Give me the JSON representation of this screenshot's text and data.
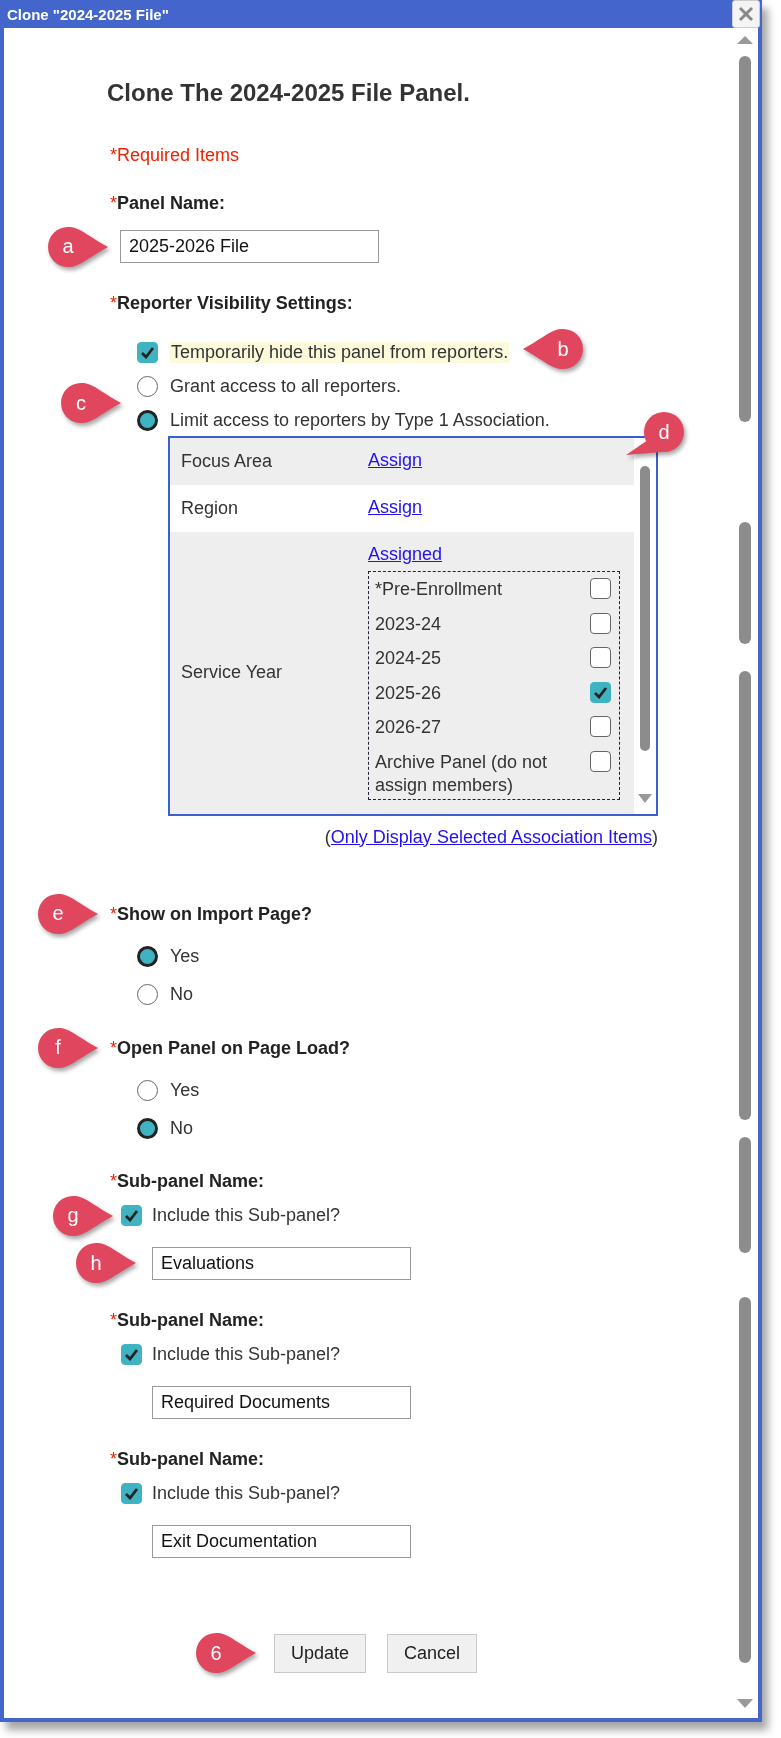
{
  "window": {
    "title": "Clone \"2024-2025 File\""
  },
  "heading": "Clone The 2024-2025 File Panel.",
  "required_note": "*Required Items",
  "panel_name": {
    "required_mark": "*",
    "label": "Panel Name:",
    "value": "2025-2026 File",
    "callout": "a"
  },
  "visibility": {
    "required_mark": "*",
    "label": "Reporter Visibility Settings:",
    "hide": {
      "label": "Temporarily hide this panel from reporters.",
      "checked": true,
      "highlighted": true,
      "callout": "b"
    },
    "access_callout": "c",
    "access_options": [
      {
        "label": "Grant access to all reporters.",
        "selected": false
      },
      {
        "label": "Limit access to reporters by Type 1 Association.",
        "selected": true
      }
    ]
  },
  "associations": {
    "callout": "d",
    "rows": [
      {
        "name": "Focus Area",
        "link": "Assign"
      },
      {
        "name": "Region",
        "link": "Assign"
      },
      {
        "name": "Service Year",
        "link": "Assigned",
        "items": [
          {
            "label": "*Pre-Enrollment",
            "checked": false
          },
          {
            "label": "2023-24",
            "checked": false
          },
          {
            "label": "2024-25",
            "checked": false
          },
          {
            "label": "2025-26",
            "checked": true
          },
          {
            "label": "2026-27",
            "checked": false
          },
          {
            "label": "Archive Panel (do not assign members)",
            "checked": false
          }
        ]
      }
    ],
    "footer_open": "(",
    "footer_link": "Only Display Selected Association Items",
    "footer_close": ")"
  },
  "questions": [
    {
      "required_mark": "*",
      "label": "Show on Import Page?",
      "callout": "e",
      "options": [
        {
          "label": "Yes",
          "selected": true
        },
        {
          "label": "No",
          "selected": false
        }
      ]
    },
    {
      "required_mark": "*",
      "label": "Open Panel on Page Load?",
      "callout": "f",
      "options": [
        {
          "label": "Yes",
          "selected": false
        },
        {
          "label": "No",
          "selected": true
        }
      ]
    }
  ],
  "subpanels": [
    {
      "required_mark": "*",
      "label": "Sub-panel Name:",
      "include_label": "Include this Sub-panel?",
      "include_checked": true,
      "include_callout": "g",
      "value": "Evaluations",
      "field_callout": "h"
    },
    {
      "required_mark": "*",
      "label": "Sub-panel Name:",
      "include_label": "Include this Sub-panel?",
      "include_checked": true,
      "value": "Required Documents"
    },
    {
      "required_mark": "*",
      "label": "Sub-panel Name:",
      "include_label": "Include this Sub-panel?",
      "include_checked": true,
      "value": "Exit Documentation"
    }
  ],
  "buttons": {
    "callout": "6",
    "items": [
      "Update",
      "Cancel"
    ]
  }
}
